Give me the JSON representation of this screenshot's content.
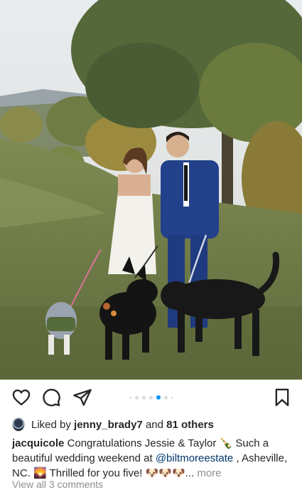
{
  "post": {
    "photo_alt": "",
    "carousel": {
      "count": 7,
      "active_index": 4
    },
    "likes": {
      "prefix": "Liked by",
      "user": "jenny_brady7",
      "middle": "and",
      "others": "81 others"
    },
    "caption": {
      "username": "jacquicole",
      "text_1": " Congratulations Jessie & Taylor 🍾 Such a beautiful wedding weekend at ",
      "mention": "@biltmoreestate",
      "text_2": " , Asheville, NC. 🌄 Thrilled for you five! 🐶🐶🐶...",
      "more": " more"
    },
    "comments_link": "View all 3 comments"
  },
  "icons": {
    "like": "heart-icon",
    "comment": "comment-icon",
    "share": "paper-plane-icon",
    "save": "bookmark-icon"
  }
}
